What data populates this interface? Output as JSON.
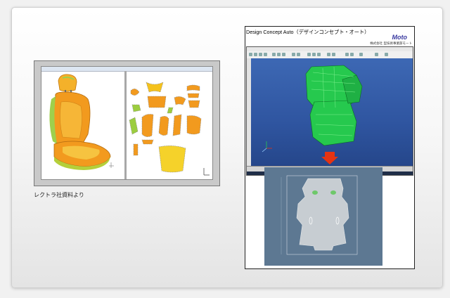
{
  "left_figure": {
    "caption": "レクトラ社資料より"
  },
  "right_figure": {
    "title": "Design Concept Auto（デザインコンセプト・オート）",
    "logo": "Moto",
    "company": "株式会社 型技術事業部モート"
  },
  "colors": {
    "card_background": "#ffffff",
    "cad_viewport": "#3d68b4",
    "seat_model": "#22c84a",
    "seat_orange": "#f29a1e",
    "arrow": "#e63312",
    "flattened_panel": "#5d7892"
  },
  "icons": {
    "arrow": "down-arrow-icon"
  }
}
